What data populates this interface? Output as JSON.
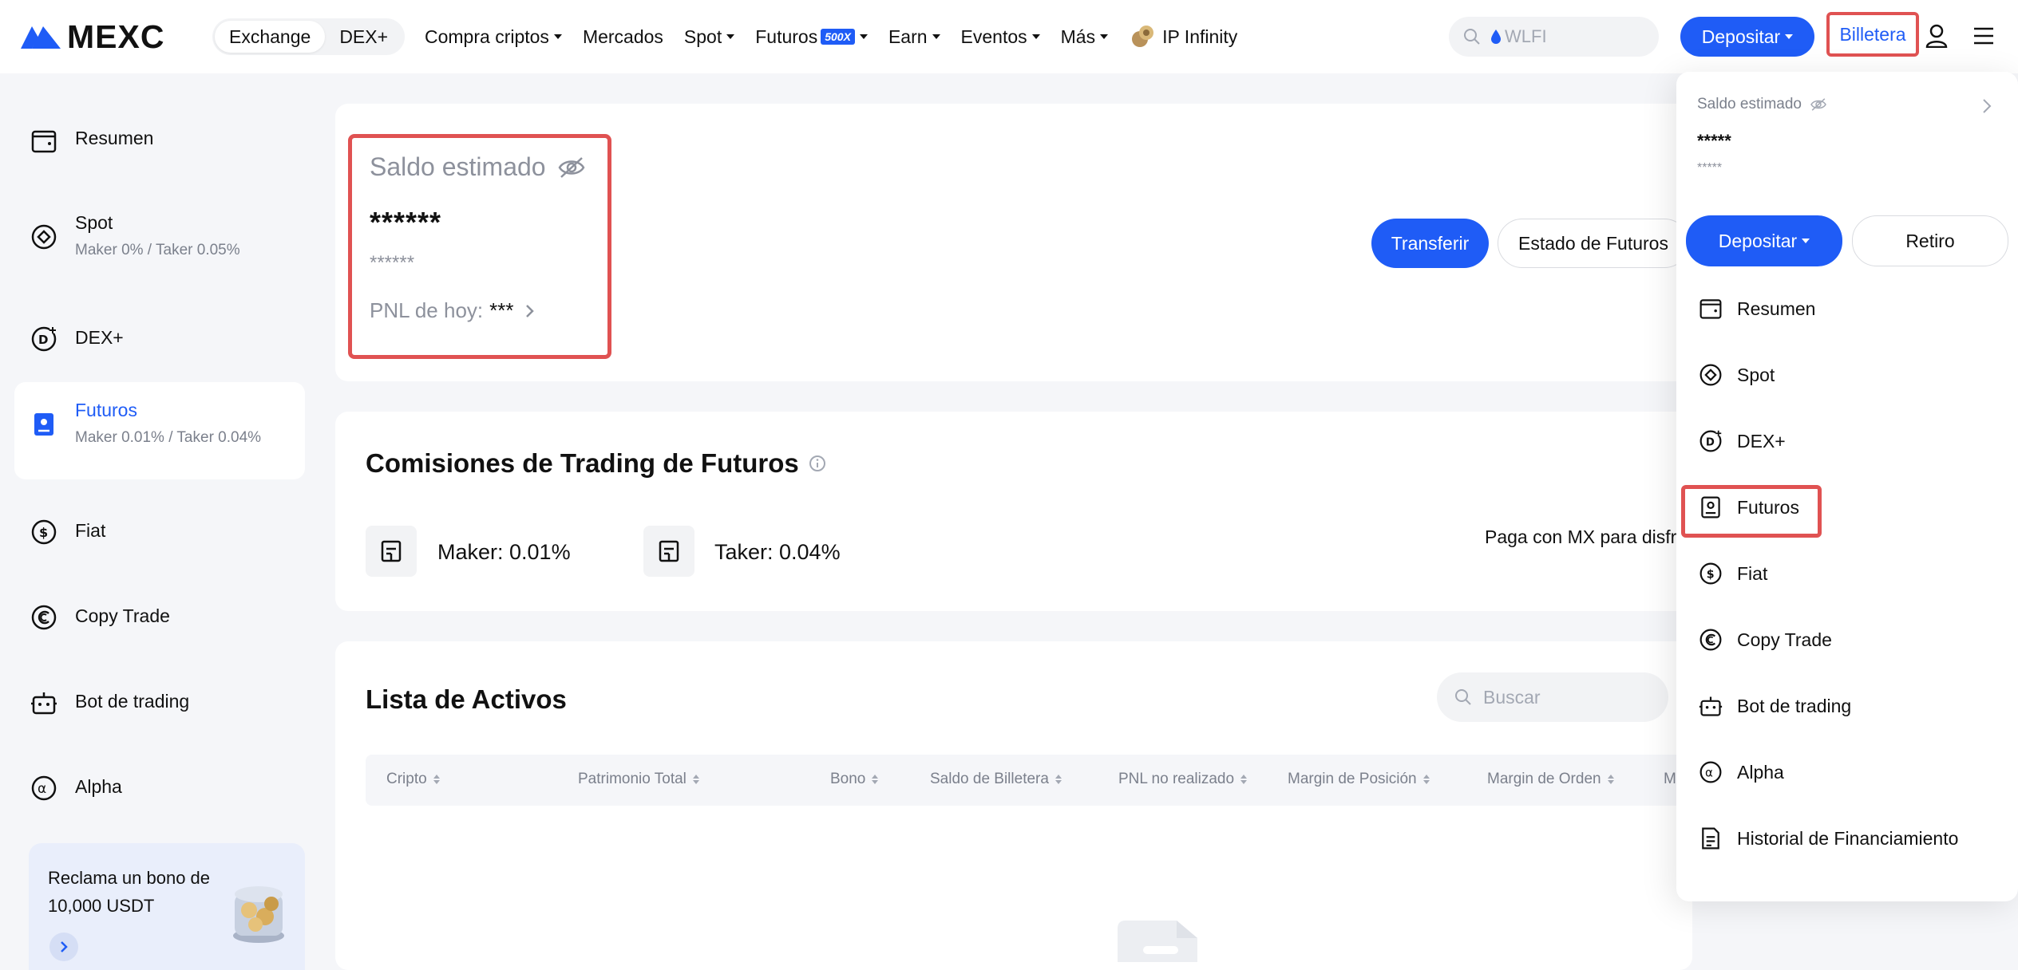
{
  "header": {
    "brand": "MEXC",
    "segments": [
      "Exchange",
      "DEX+"
    ],
    "nav": [
      {
        "label": "Compra criptos",
        "caret": true
      },
      {
        "label": "Mercados",
        "caret": false
      },
      {
        "label": "Spot",
        "caret": true
      },
      {
        "label": "Futuros",
        "badge": "500X",
        "caret": true
      },
      {
        "label": "Earn",
        "caret": true
      },
      {
        "label": "Eventos",
        "caret": true
      },
      {
        "label": "Más",
        "caret": true
      },
      {
        "label": "IP Infinity",
        "caret": false
      }
    ],
    "search_placeholder": "WLFI",
    "deposit_label": "Depositar",
    "wallet_label": "Billetera",
    "accent": "#1f5cf6",
    "highlight": "#e05252"
  },
  "sidebar": {
    "items": [
      {
        "label": "Resumen",
        "icon": "wallet-icon"
      },
      {
        "label": "Spot",
        "sub": "Maker 0% / Taker 0.05%",
        "icon": "spot-icon"
      },
      {
        "label": "DEX+",
        "icon": "dex-icon"
      },
      {
        "label": "Futuros",
        "sub": "Maker 0.01% / Taker 0.04%",
        "icon": "futures-icon",
        "active": true
      },
      {
        "label": "Fiat",
        "icon": "dollar-icon"
      },
      {
        "label": "Copy Trade",
        "icon": "copy-trade-icon"
      },
      {
        "label": "Bot de trading",
        "icon": "bot-icon"
      },
      {
        "label": "Alpha",
        "icon": "alpha-icon"
      }
    ],
    "promo": "Reclama un bono de 10,000 USDT"
  },
  "balance": {
    "label": "Saldo estimado",
    "value": "******",
    "sub": "******",
    "pnl_label": "PNL de hoy:",
    "pnl_value": "***"
  },
  "actions": {
    "transfer": "Transferir",
    "futures_status": "Estado de Futuros"
  },
  "fees": {
    "title": "Comisiones de Trading de Futuros",
    "maker": "Maker: 0.01%",
    "taker": "Taker: 0.04%",
    "mx_note": "Paga con MX para disfru"
  },
  "assets": {
    "title": "Lista de Activos",
    "search_placeholder": "Buscar",
    "columns": [
      "Cripto",
      "Patrimonio Total",
      "Bono",
      "Saldo de Billetera",
      "PNL no realizado",
      "Margin de Posición",
      "Margin de Orden",
      "M"
    ]
  },
  "dropdown": {
    "balance_label": "Saldo estimado",
    "balance_value": "*****",
    "balance_sub": "*****",
    "deposit_label": "Depositar",
    "withdraw_label": "Retiro",
    "items": [
      {
        "label": "Resumen",
        "icon": "wallet-icon"
      },
      {
        "label": "Spot",
        "icon": "spot-icon"
      },
      {
        "label": "DEX+",
        "icon": "dex-icon"
      },
      {
        "label": "Futuros",
        "icon": "futures-icon"
      },
      {
        "label": "Fiat",
        "icon": "dollar-icon"
      },
      {
        "label": "Copy Trade",
        "icon": "copy-trade-icon"
      },
      {
        "label": "Bot de trading",
        "icon": "bot-icon"
      },
      {
        "label": "Alpha",
        "icon": "alpha-icon"
      },
      {
        "label": "Historial de Financiamiento",
        "icon": "document-icon"
      }
    ]
  }
}
